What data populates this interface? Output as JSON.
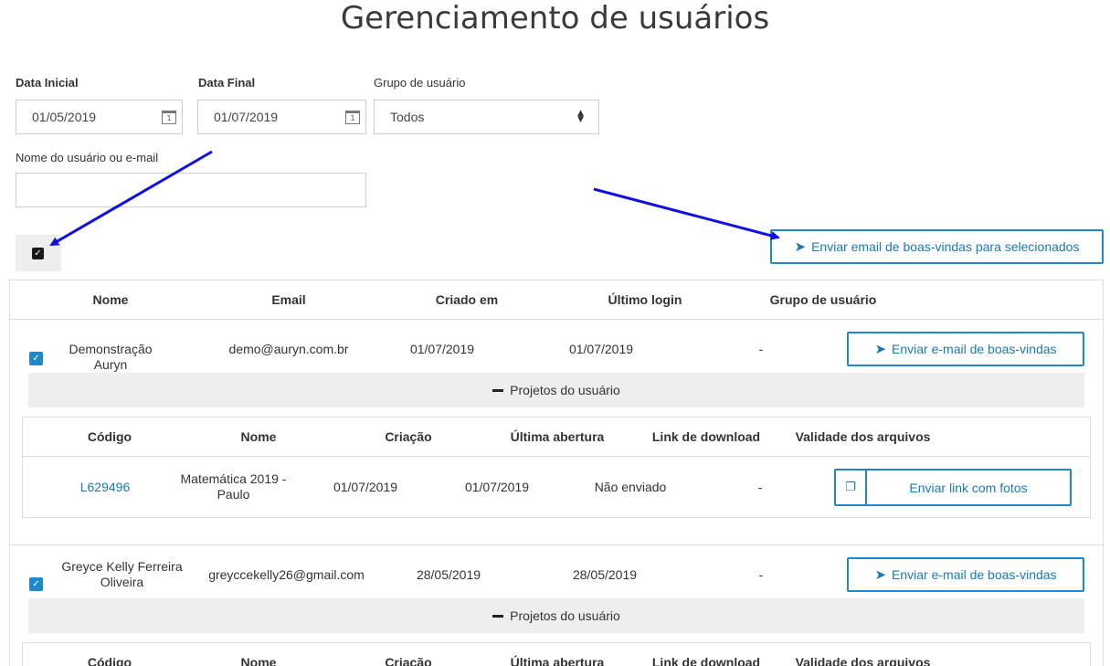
{
  "page": {
    "title": "Gerenciamento de usuários"
  },
  "filters": {
    "start_label": "Data Inicial",
    "start_value": "01/05/2019",
    "end_label": "Data Final",
    "end_value": "01/07/2019",
    "group_label": "Grupo de usuário",
    "group_value": "Todos",
    "search_label": "Nome do usuário ou e-mail",
    "search_value": "",
    "calendar_day": "1"
  },
  "bulk": {
    "send_selected_label": "Enviar email de boas-vindas para selecionados",
    "select_all_checked": true
  },
  "table": {
    "headers": [
      "Nome",
      "Email",
      "Criado em",
      "Último login",
      "Grupo de usuário"
    ],
    "users": [
      {
        "checked": true,
        "name": "Demonstração Auryn",
        "email": "demo@auryn.com.br",
        "created": "01/07/2019",
        "last_login": "01/07/2019",
        "group": "-",
        "send_label": "Enviar e-mail de boas-vindas",
        "projects_toggle": "Projetos do usuário",
        "project_headers": [
          "Código",
          "Nome",
          "Criação",
          "Última abertura",
          "Link de download",
          "Validade dos arquivos"
        ],
        "projects": [
          {
            "code": "L629496",
            "name": "Matemática 2019 - Paulo",
            "created": "01/07/2019",
            "last_open": "01/07/2019",
            "download_link": "Não enviado",
            "validity": "-",
            "action_label": "Enviar link com fotos"
          }
        ]
      },
      {
        "checked": true,
        "name": "Greyce Kelly Ferreira Oliveira",
        "email": "greyccekelly26@gmail.com",
        "created": "28/05/2019",
        "last_login": "28/05/2019",
        "group": "-",
        "send_label": "Enviar e-mail de boas-vindas",
        "projects_toggle": "Projetos do usuário",
        "project_headers": [
          "Código",
          "Nome",
          "Criação",
          "Última abertura",
          "Link de download",
          "Validade dos arquivos"
        ]
      }
    ]
  },
  "colors": {
    "accent": "#1f88c9",
    "annotation_arrow": "#1010e0",
    "row_band": "#eeeeee"
  },
  "icons": {
    "send": "paper-plane-icon",
    "calendar": "calendar-icon",
    "copy": "copy-icon",
    "minus": "minus-icon",
    "select_arrows": "sort-arrows-icon"
  }
}
